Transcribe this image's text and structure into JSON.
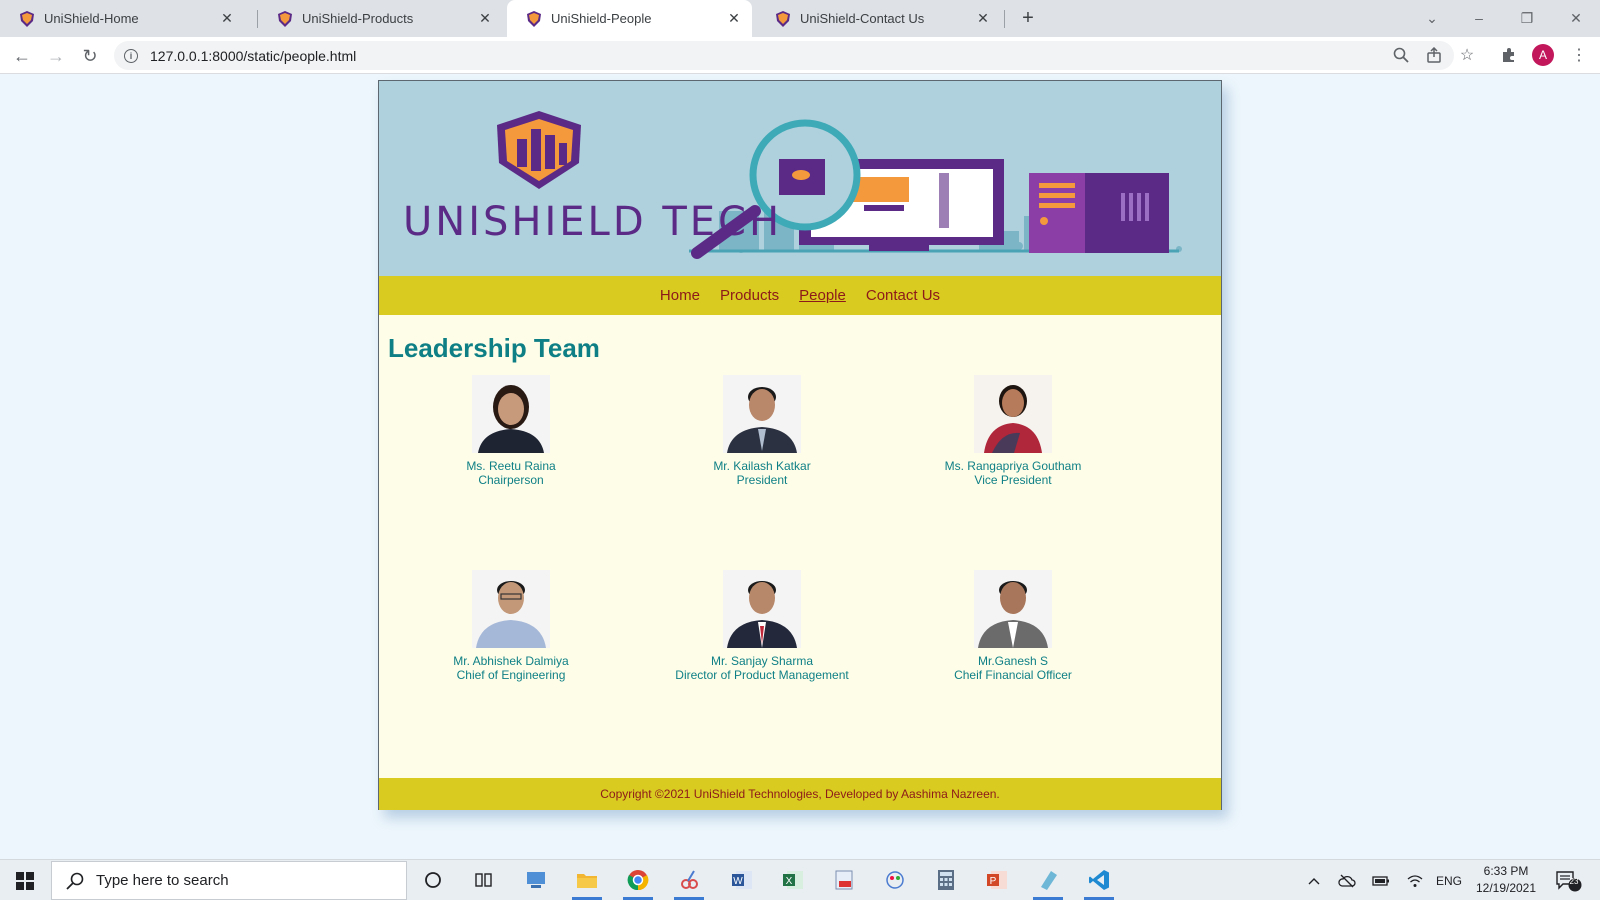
{
  "browser": {
    "tabs": [
      {
        "label": "UniShield-Home"
      },
      {
        "label": "UniShield-Products"
      },
      {
        "label": "UniShield-People"
      },
      {
        "label": "UniShield-Contact Us"
      }
    ],
    "url": "127.0.0.1:8000/static/people.html",
    "profile_initial": "A"
  },
  "site": {
    "brand": "UNISHIELD TECH",
    "nav": {
      "home": "Home",
      "products": "Products",
      "people": "People",
      "contact": "Contact Us"
    },
    "heading": "Leadership Team",
    "people": [
      {
        "name": "Ms. Reetu Raina",
        "title": "Chairperson"
      },
      {
        "name": "Mr. Kailash Katkar",
        "title": "President"
      },
      {
        "name": "Ms. Rangapriya Goutham",
        "title": "Vice President"
      },
      {
        "name": "Mr. Abhishek Dalmiya",
        "title": "Chief of Engineering"
      },
      {
        "name": "Mr. Sanjay Sharma",
        "title": "Director of Product Management"
      },
      {
        "name": "Mr.Ganesh S",
        "title": "Cheif Financial Officer"
      }
    ],
    "footer": "Copyright ©2021 UniShield Technologies, Developed by Aashima Nazreen."
  },
  "taskbar": {
    "search_placeholder": "Type here to search",
    "language": "ENG",
    "time": "6:33 PM",
    "date": "12/19/2021",
    "notification_count": "23"
  },
  "colors": {
    "banner": "#aed1dd",
    "nav_strip": "#d9cb1f",
    "nav_link": "#8c1a1a",
    "heading": "#0f7f86",
    "content_bg": "#fefee8"
  }
}
